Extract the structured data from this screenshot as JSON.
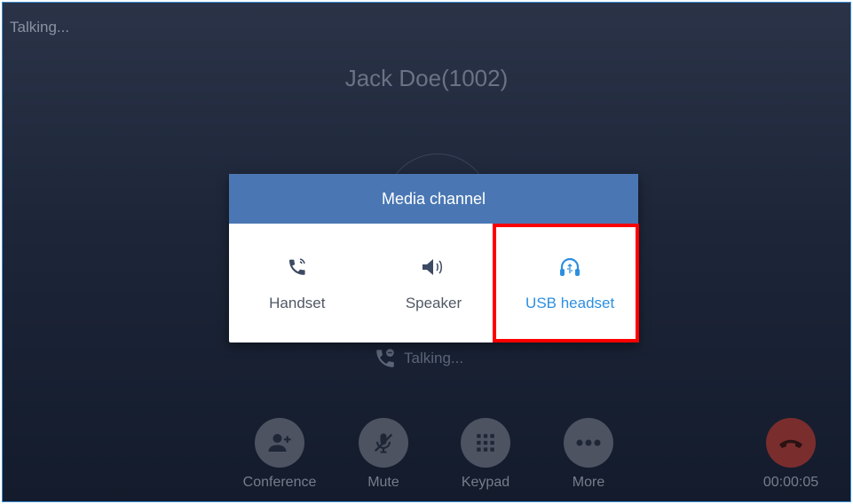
{
  "screen": {
    "status_text": "Talking...",
    "caller_name": "Jack Doe(1002)",
    "call_status": "Talking...",
    "timer": "00:00:05"
  },
  "controls": [
    {
      "label": "Conference",
      "icon": "add-person-icon"
    },
    {
      "label": "Mute",
      "icon": "mic-muted-icon"
    },
    {
      "label": "Keypad",
      "icon": "keypad-icon"
    },
    {
      "label": "More",
      "icon": "more-dots-icon"
    }
  ],
  "dialog": {
    "title": "Media channel",
    "options": [
      {
        "label": "Handset",
        "icon": "handset-icon",
        "selected": false
      },
      {
        "label": "Speaker",
        "icon": "speaker-icon",
        "selected": false
      },
      {
        "label": "USB headset",
        "icon": "usb-headset-icon",
        "selected": true
      }
    ]
  },
  "colors": {
    "header": "#4a77b3",
    "selected": "#2d8fe0",
    "highlight": "#ff0000",
    "hangup": "#7a2d2d"
  }
}
